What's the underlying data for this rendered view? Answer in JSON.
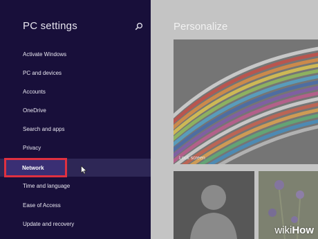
{
  "sidebar": {
    "title": "PC settings",
    "search_icon": "search-icon",
    "items": [
      {
        "label": "Activate Windows"
      },
      {
        "label": "PC and devices"
      },
      {
        "label": "Accounts"
      },
      {
        "label": "OneDrive"
      },
      {
        "label": "Search and apps"
      },
      {
        "label": "Privacy"
      },
      {
        "label": "Network"
      },
      {
        "label": "Time and language"
      },
      {
        "label": "Ease of Access"
      },
      {
        "label": "Update and recovery"
      }
    ],
    "selected_item": "Network"
  },
  "main": {
    "title": "Personalize",
    "lock_screen_label": "Lock screen"
  },
  "watermark": {
    "part1": "wiki",
    "part2": "How"
  },
  "colors": {
    "sidebar_bg": "#180f3a",
    "highlight_border": "#e03040",
    "main_bg": "#c4c4c4"
  }
}
